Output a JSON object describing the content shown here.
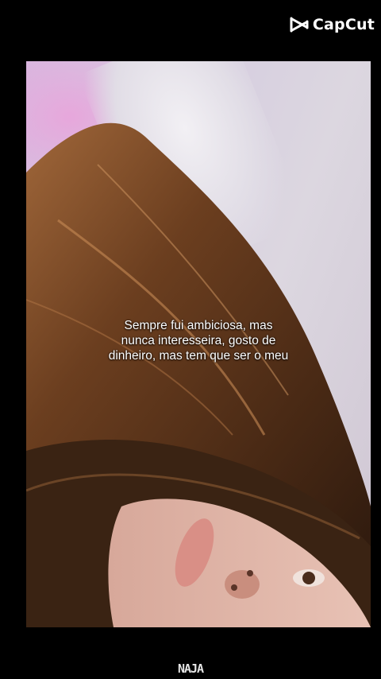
{
  "brand": {
    "logo_text": "CapCut",
    "logo_icon": "capcut-icon"
  },
  "video": {
    "subtitle_lines": [
      "Sempre fui ambiciosa, mas",
      "nunca interesseira, gosto de",
      "dinheiro, mas tem que ser o meu"
    ]
  },
  "footer": {
    "watermark": "NAJA"
  },
  "colors": {
    "background": "#000000",
    "hair": "#6b3e1f",
    "wall": "#d8cfe0"
  }
}
